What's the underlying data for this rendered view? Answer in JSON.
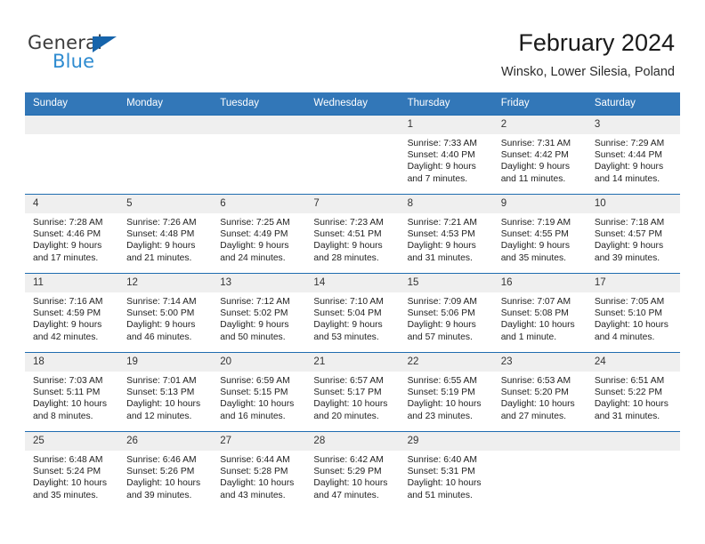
{
  "brand": {
    "name_top": "General",
    "name_bottom": "Blue",
    "accent_color": "#1664ab",
    "accent_color_light": "#2e8bd0"
  },
  "header": {
    "title": "February 2024",
    "subtitle": "Winsko, Lower Silesia, Poland"
  },
  "theme": {
    "header_bg": "#3277b8",
    "row_divider": "#1f6cb0",
    "day_band_bg": "#efefef"
  },
  "weekdays": [
    "Sunday",
    "Monday",
    "Tuesday",
    "Wednesday",
    "Thursday",
    "Friday",
    "Saturday"
  ],
  "weeks": [
    [
      {
        "day": "",
        "sunrise": "",
        "sunset": "",
        "daylight_line1": "",
        "daylight_line2": ""
      },
      {
        "day": "",
        "sunrise": "",
        "sunset": "",
        "daylight_line1": "",
        "daylight_line2": ""
      },
      {
        "day": "",
        "sunrise": "",
        "sunset": "",
        "daylight_line1": "",
        "daylight_line2": ""
      },
      {
        "day": "",
        "sunrise": "",
        "sunset": "",
        "daylight_line1": "",
        "daylight_line2": ""
      },
      {
        "day": "1",
        "sunrise": "Sunrise: 7:33 AM",
        "sunset": "Sunset: 4:40 PM",
        "daylight_line1": "Daylight: 9 hours",
        "daylight_line2": "and 7 minutes."
      },
      {
        "day": "2",
        "sunrise": "Sunrise: 7:31 AM",
        "sunset": "Sunset: 4:42 PM",
        "daylight_line1": "Daylight: 9 hours",
        "daylight_line2": "and 11 minutes."
      },
      {
        "day": "3",
        "sunrise": "Sunrise: 7:29 AM",
        "sunset": "Sunset: 4:44 PM",
        "daylight_line1": "Daylight: 9 hours",
        "daylight_line2": "and 14 minutes."
      }
    ],
    [
      {
        "day": "4",
        "sunrise": "Sunrise: 7:28 AM",
        "sunset": "Sunset: 4:46 PM",
        "daylight_line1": "Daylight: 9 hours",
        "daylight_line2": "and 17 minutes."
      },
      {
        "day": "5",
        "sunrise": "Sunrise: 7:26 AM",
        "sunset": "Sunset: 4:48 PM",
        "daylight_line1": "Daylight: 9 hours",
        "daylight_line2": "and 21 minutes."
      },
      {
        "day": "6",
        "sunrise": "Sunrise: 7:25 AM",
        "sunset": "Sunset: 4:49 PM",
        "daylight_line1": "Daylight: 9 hours",
        "daylight_line2": "and 24 minutes."
      },
      {
        "day": "7",
        "sunrise": "Sunrise: 7:23 AM",
        "sunset": "Sunset: 4:51 PM",
        "daylight_line1": "Daylight: 9 hours",
        "daylight_line2": "and 28 minutes."
      },
      {
        "day": "8",
        "sunrise": "Sunrise: 7:21 AM",
        "sunset": "Sunset: 4:53 PM",
        "daylight_line1": "Daylight: 9 hours",
        "daylight_line2": "and 31 minutes."
      },
      {
        "day": "9",
        "sunrise": "Sunrise: 7:19 AM",
        "sunset": "Sunset: 4:55 PM",
        "daylight_line1": "Daylight: 9 hours",
        "daylight_line2": "and 35 minutes."
      },
      {
        "day": "10",
        "sunrise": "Sunrise: 7:18 AM",
        "sunset": "Sunset: 4:57 PM",
        "daylight_line1": "Daylight: 9 hours",
        "daylight_line2": "and 39 minutes."
      }
    ],
    [
      {
        "day": "11",
        "sunrise": "Sunrise: 7:16 AM",
        "sunset": "Sunset: 4:59 PM",
        "daylight_line1": "Daylight: 9 hours",
        "daylight_line2": "and 42 minutes."
      },
      {
        "day": "12",
        "sunrise": "Sunrise: 7:14 AM",
        "sunset": "Sunset: 5:00 PM",
        "daylight_line1": "Daylight: 9 hours",
        "daylight_line2": "and 46 minutes."
      },
      {
        "day": "13",
        "sunrise": "Sunrise: 7:12 AM",
        "sunset": "Sunset: 5:02 PM",
        "daylight_line1": "Daylight: 9 hours",
        "daylight_line2": "and 50 minutes."
      },
      {
        "day": "14",
        "sunrise": "Sunrise: 7:10 AM",
        "sunset": "Sunset: 5:04 PM",
        "daylight_line1": "Daylight: 9 hours",
        "daylight_line2": "and 53 minutes."
      },
      {
        "day": "15",
        "sunrise": "Sunrise: 7:09 AM",
        "sunset": "Sunset: 5:06 PM",
        "daylight_line1": "Daylight: 9 hours",
        "daylight_line2": "and 57 minutes."
      },
      {
        "day": "16",
        "sunrise": "Sunrise: 7:07 AM",
        "sunset": "Sunset: 5:08 PM",
        "daylight_line1": "Daylight: 10 hours",
        "daylight_line2": "and 1 minute."
      },
      {
        "day": "17",
        "sunrise": "Sunrise: 7:05 AM",
        "sunset": "Sunset: 5:10 PM",
        "daylight_line1": "Daylight: 10 hours",
        "daylight_line2": "and 4 minutes."
      }
    ],
    [
      {
        "day": "18",
        "sunrise": "Sunrise: 7:03 AM",
        "sunset": "Sunset: 5:11 PM",
        "daylight_line1": "Daylight: 10 hours",
        "daylight_line2": "and 8 minutes."
      },
      {
        "day": "19",
        "sunrise": "Sunrise: 7:01 AM",
        "sunset": "Sunset: 5:13 PM",
        "daylight_line1": "Daylight: 10 hours",
        "daylight_line2": "and 12 minutes."
      },
      {
        "day": "20",
        "sunrise": "Sunrise: 6:59 AM",
        "sunset": "Sunset: 5:15 PM",
        "daylight_line1": "Daylight: 10 hours",
        "daylight_line2": "and 16 minutes."
      },
      {
        "day": "21",
        "sunrise": "Sunrise: 6:57 AM",
        "sunset": "Sunset: 5:17 PM",
        "daylight_line1": "Daylight: 10 hours",
        "daylight_line2": "and 20 minutes."
      },
      {
        "day": "22",
        "sunrise": "Sunrise: 6:55 AM",
        "sunset": "Sunset: 5:19 PM",
        "daylight_line1": "Daylight: 10 hours",
        "daylight_line2": "and 23 minutes."
      },
      {
        "day": "23",
        "sunrise": "Sunrise: 6:53 AM",
        "sunset": "Sunset: 5:20 PM",
        "daylight_line1": "Daylight: 10 hours",
        "daylight_line2": "and 27 minutes."
      },
      {
        "day": "24",
        "sunrise": "Sunrise: 6:51 AM",
        "sunset": "Sunset: 5:22 PM",
        "daylight_line1": "Daylight: 10 hours",
        "daylight_line2": "and 31 minutes."
      }
    ],
    [
      {
        "day": "25",
        "sunrise": "Sunrise: 6:48 AM",
        "sunset": "Sunset: 5:24 PM",
        "daylight_line1": "Daylight: 10 hours",
        "daylight_line2": "and 35 minutes."
      },
      {
        "day": "26",
        "sunrise": "Sunrise: 6:46 AM",
        "sunset": "Sunset: 5:26 PM",
        "daylight_line1": "Daylight: 10 hours",
        "daylight_line2": "and 39 minutes."
      },
      {
        "day": "27",
        "sunrise": "Sunrise: 6:44 AM",
        "sunset": "Sunset: 5:28 PM",
        "daylight_line1": "Daylight: 10 hours",
        "daylight_line2": "and 43 minutes."
      },
      {
        "day": "28",
        "sunrise": "Sunrise: 6:42 AM",
        "sunset": "Sunset: 5:29 PM",
        "daylight_line1": "Daylight: 10 hours",
        "daylight_line2": "and 47 minutes."
      },
      {
        "day": "29",
        "sunrise": "Sunrise: 6:40 AM",
        "sunset": "Sunset: 5:31 PM",
        "daylight_line1": "Daylight: 10 hours",
        "daylight_line2": "and 51 minutes."
      },
      {
        "day": "",
        "sunrise": "",
        "sunset": "",
        "daylight_line1": "",
        "daylight_line2": ""
      },
      {
        "day": "",
        "sunrise": "",
        "sunset": "",
        "daylight_line1": "",
        "daylight_line2": ""
      }
    ]
  ]
}
